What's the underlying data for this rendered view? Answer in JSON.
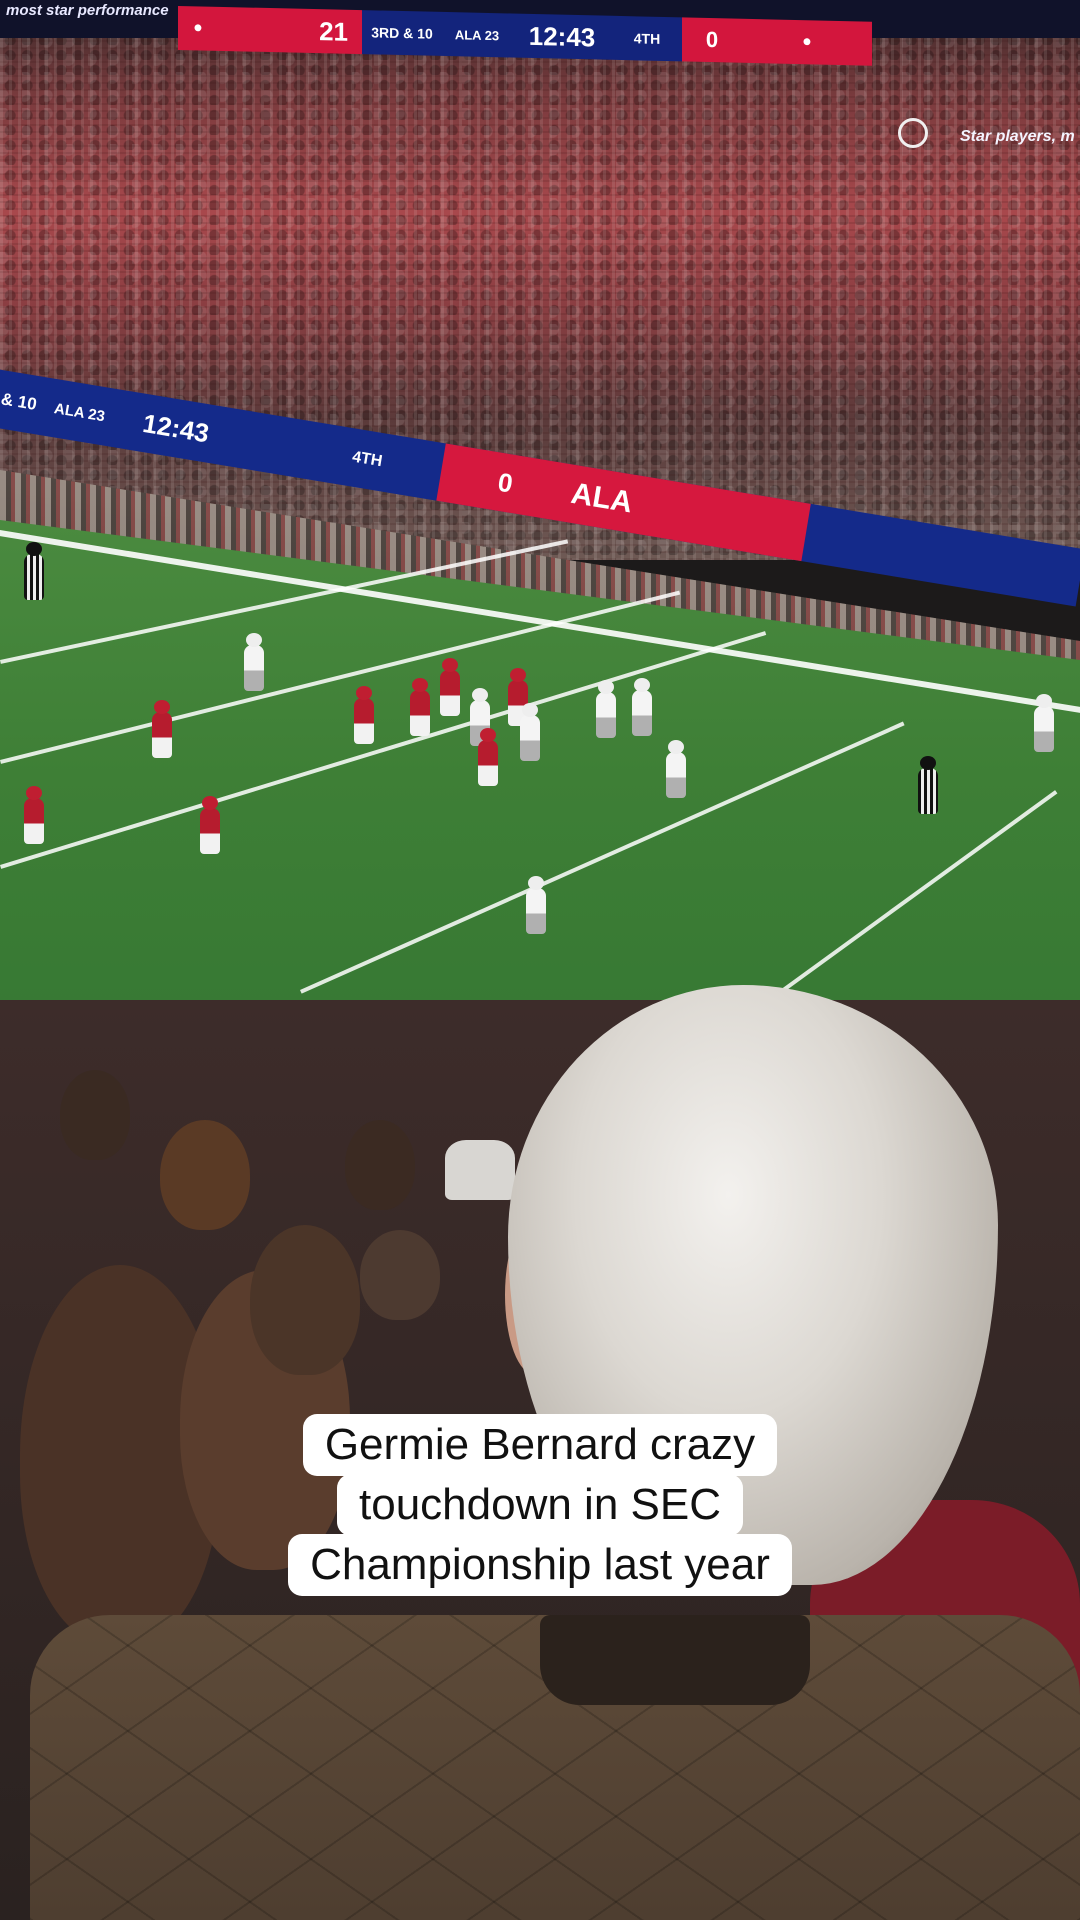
{
  "video": {
    "description_label": "",
    "caption_lines": [
      "Germie Bernard crazy",
      "touchdown in SEC",
      "Championship last year"
    ]
  },
  "scoreboard_top": {
    "left_text": "most star performance",
    "home_score": "21",
    "down_distance": "3RD & 10",
    "ball_on": "ALA 23",
    "clock": "12:43",
    "quarter": "4TH",
    "away_score": "0",
    "right_text": "Star players, m"
  },
  "scoreboard_ribbon": {
    "down_distance": "& 10",
    "ball_on": "ALA 23",
    "clock": "12:43",
    "quarter": "4TH",
    "score": "0",
    "team": "ALA"
  },
  "colors": {
    "ribbon_blue": "#142a8a",
    "ribbon_red": "#d6183e",
    "field_green": "#3e7f36",
    "caption_bg": "#ffffff",
    "caption_text": "#111111"
  }
}
